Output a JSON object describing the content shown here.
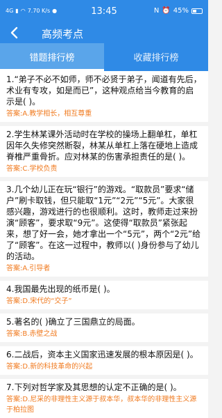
{
  "status": {
    "network": "4G",
    "speed": "7.70 K/s",
    "time": "13:45",
    "battery_text": "45%",
    "battery_level": 0.45
  },
  "header": {
    "title": "高频考点"
  },
  "tabs": [
    {
      "label": "错题排行榜"
    },
    {
      "label": "收藏排行榜"
    }
  ],
  "questions": [
    {
      "text": "1.“弟子不必不如师，师不必贤于弟子，闻道有先后，术业有专攻，如是而已”，这种观点给当今教育的启示是(      )。",
      "answer": "答案:A.教学相长，相互尊重"
    },
    {
      "text": "2.学生林某课外活动时在学校的操场上翻单杠，单杠因年久失修突然断裂，林某从单杠上落在硬地上造成脊椎严重骨折。应对林某的伤害承担责任的是(      )。",
      "answer": "答案:C.学校负责"
    },
    {
      "text": "3.几个幼儿正在玩“银行”的游戏。“取款员”要求“储户”刷卡取钱，但只能取“1元”“2元”“5元”。大家很感兴趣，游戏进行的也很顺利。这时，教师走过来扮演“顾客”，要求取“9元”。这使得“取款员”紧张起来，想了好一会，她才拿出一个“5元”，两个“2元”给了“顾客”。在这一过程中，教师以(      )身份参与了幼儿的活动。",
      "answer": "答案:A.引导者"
    },
    {
      "text": "4.我国最先出现的纸币是(      )。",
      "answer": "答案:D.宋代的“交子”"
    },
    {
      "text": "5.著名的(      )确立了三国鼎立的局面。",
      "answer": "答案:B.赤壁之战"
    },
    {
      "text": "6.二战后，资本主义国家迅速发展的根本原因是(      )。",
      "answer": "答案:D.新的科技革命的兴起"
    },
    {
      "text": "7.下列对哲学家及其思想的认定不正确的是(      )。",
      "answer": "答案:D.尼采的非理性主义源于叔本华，叔本华的非理性主义源于柏拉图"
    }
  ]
}
